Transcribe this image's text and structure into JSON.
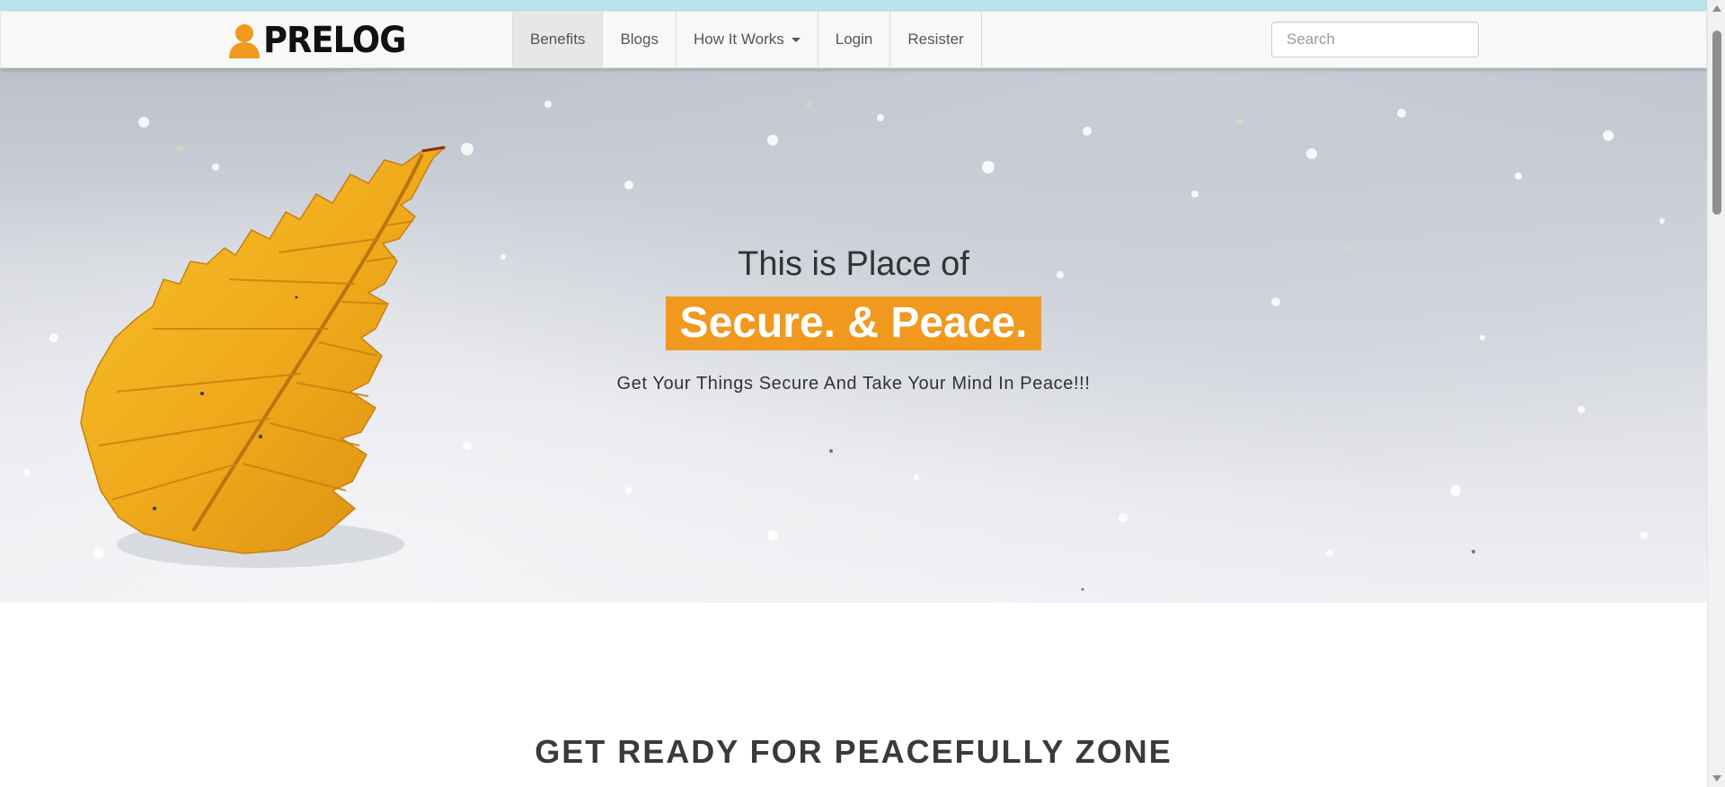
{
  "colors": {
    "top_strip": "#b8e3ea",
    "brand_orange": "#f0991e",
    "text_dark": "#333333",
    "nav_text": "#555555"
  },
  "navbar": {
    "brand": {
      "icon": "user-silhouette-icon",
      "text": "PRELOG"
    },
    "items": [
      {
        "label": "Benefits",
        "active": true
      },
      {
        "label": "Blogs",
        "active": false
      },
      {
        "label": "How It Works",
        "active": false,
        "dropdown": true
      },
      {
        "label": "Login",
        "active": false
      },
      {
        "label": "Resister",
        "active": false
      }
    ],
    "search": {
      "placeholder": "Search",
      "value": ""
    }
  },
  "hero": {
    "background": "orange-leaf-on-snow",
    "title": "This is Place of",
    "highlight": "Secure. & Peace.",
    "subtitle": "Get Your Things Secure And Take Your Mind In Peace!!!"
  },
  "section": {
    "heading": "GET READY FOR PEACEFULLY ZONE"
  }
}
